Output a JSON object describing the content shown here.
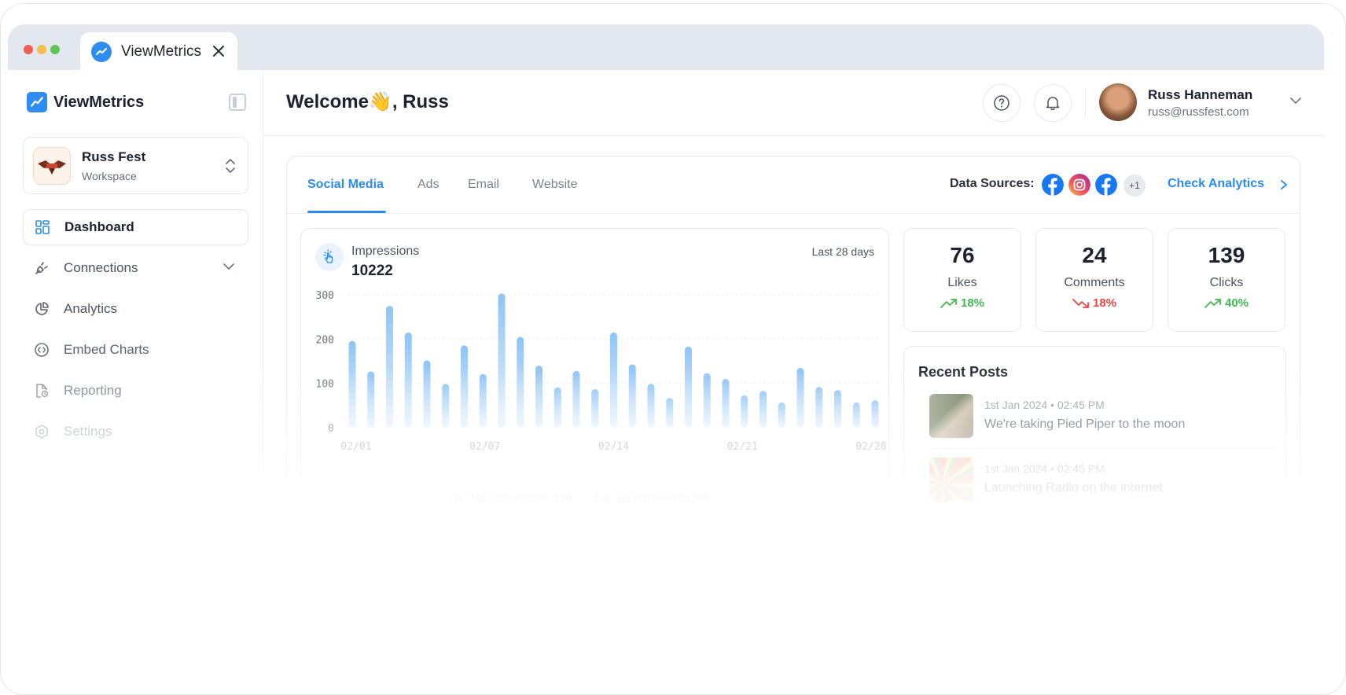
{
  "browser": {
    "tab_title": "ViewMetrics",
    "traffic_lights": [
      "#ee5f57",
      "#f5bd4f",
      "#5fc454"
    ]
  },
  "sidebar": {
    "brand": "ViewMetrics",
    "workspace": {
      "name": "Russ Fest",
      "subtitle": "Workspace"
    },
    "items": [
      {
        "label": "Dashboard",
        "icon": "dashboard-icon",
        "active": true
      },
      {
        "label": "Connections",
        "icon": "plug-icon",
        "expandable": true
      },
      {
        "label": "Analytics",
        "icon": "pie-chart-icon"
      },
      {
        "label": "Embed Charts",
        "icon": "code-icon"
      },
      {
        "label": "Reporting",
        "icon": "report-file-icon"
      },
      {
        "label": "Settings",
        "icon": "settings-icon"
      }
    ]
  },
  "header": {
    "welcome": "Welcome👋, Russ",
    "user": {
      "name": "Russ Hanneman",
      "email": "russ@russfest.com"
    }
  },
  "tabs": [
    {
      "label": "Social Media",
      "active": true
    },
    {
      "label": "Ads"
    },
    {
      "label": "Email"
    },
    {
      "label": "Website"
    }
  ],
  "data_sources": {
    "label": "Data Sources:",
    "icons": [
      "facebook-icon",
      "instagram-icon",
      "facebook-icon"
    ],
    "more": "+1",
    "check_analytics": "Check Analytics"
  },
  "impressions": {
    "label": "Impressions",
    "value": "10222",
    "range": "Last 28 days",
    "legend_total_label": "Total Impressions:",
    "legend_total_value": "120",
    "legend_avg_label": "Avg. Impressions/day:",
    "legend_avg_value": "90"
  },
  "stats": [
    {
      "value": "76",
      "label": "Likes",
      "change": "18%",
      "direction": "up",
      "color": "#3fb950"
    },
    {
      "value": "24",
      "label": "Comments",
      "change": "18%",
      "direction": "down",
      "color": "#ef4444"
    },
    {
      "value": "139",
      "label": "Clicks",
      "change": "40%",
      "direction": "up",
      "color": "#3fb950"
    }
  ],
  "recent_posts": {
    "title": "Recent Posts",
    "posts": [
      {
        "meta": "1st Jan 2024 • 02:45 PM",
        "title": "We're taking Pied Piper to the moon"
      },
      {
        "meta": "1st Jan 2024 • 02:45 PM",
        "title": "Launching Radio on the internet"
      }
    ]
  },
  "chart_data": {
    "type": "bar",
    "title": "Impressions",
    "x_tick_labels": [
      "02/01",
      "02/07",
      "02/14",
      "02/21",
      "02/28"
    ],
    "y_tick_labels": [
      "0",
      "100",
      "200",
      "300"
    ],
    "ylim": [
      0,
      300
    ],
    "values": [
      196,
      127,
      275,
      215,
      152,
      99,
      186,
      121,
      303,
      205,
      140,
      91,
      128,
      87,
      215,
      143,
      99,
      67,
      183,
      123,
      110,
      73,
      83,
      57,
      135,
      92,
      85,
      57,
      62
    ],
    "color": "#9fcef7"
  }
}
